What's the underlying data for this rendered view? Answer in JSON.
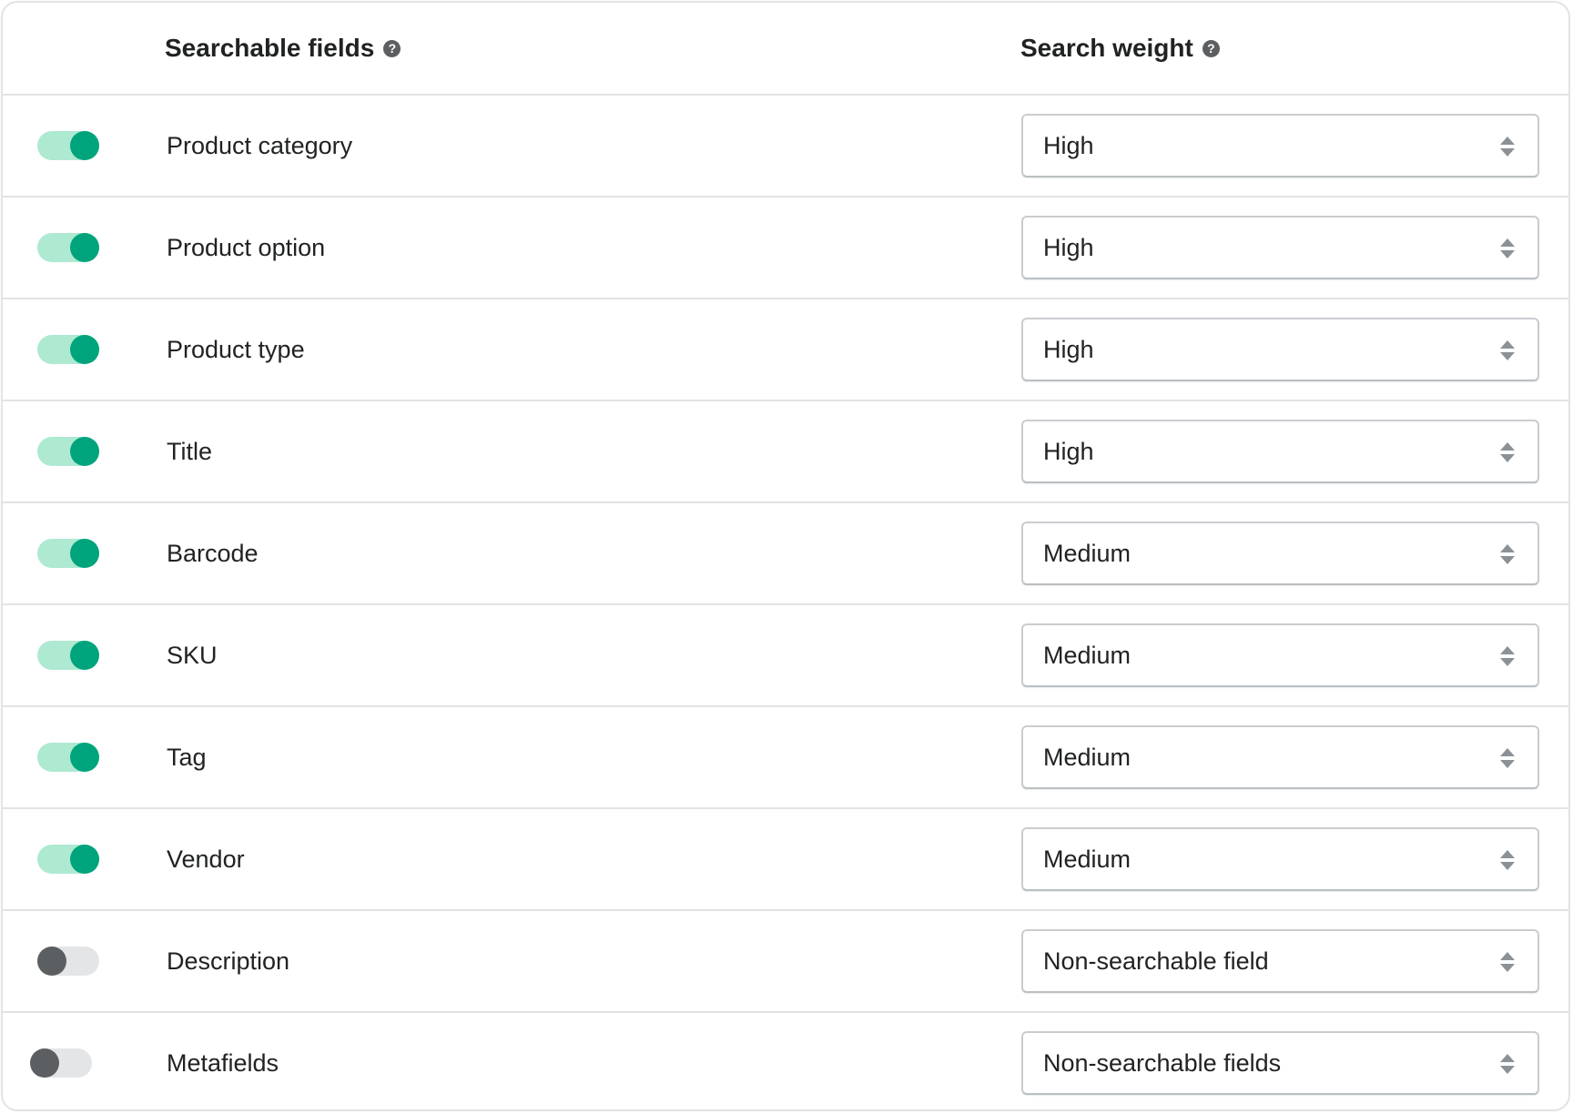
{
  "header": {
    "fields_label": "Searchable fields",
    "weight_label": "Search weight",
    "help_glyph": "?"
  },
  "colors": {
    "toggle_on_track": "#aee9d1",
    "toggle_on_knob": "#00a47c",
    "toggle_off_track": "#e4e5e7",
    "toggle_off_knob": "#5c5f62",
    "border": "#e1e3e5"
  },
  "rows": [
    {
      "label": "Product category",
      "enabled": true,
      "weight": "High"
    },
    {
      "label": "Product option",
      "enabled": true,
      "weight": "High"
    },
    {
      "label": "Product type",
      "enabled": true,
      "weight": "High"
    },
    {
      "label": "Title",
      "enabled": true,
      "weight": "High"
    },
    {
      "label": "Barcode",
      "enabled": true,
      "weight": "Medium"
    },
    {
      "label": "SKU",
      "enabled": true,
      "weight": "Medium"
    },
    {
      "label": "Tag",
      "enabled": true,
      "weight": "Medium"
    },
    {
      "label": "Vendor",
      "enabled": true,
      "weight": "Medium"
    },
    {
      "label": "Description",
      "enabled": false,
      "weight": "Non-searchable field"
    },
    {
      "label": "Metafields",
      "enabled": false,
      "weight": "Non-searchable fields"
    }
  ]
}
